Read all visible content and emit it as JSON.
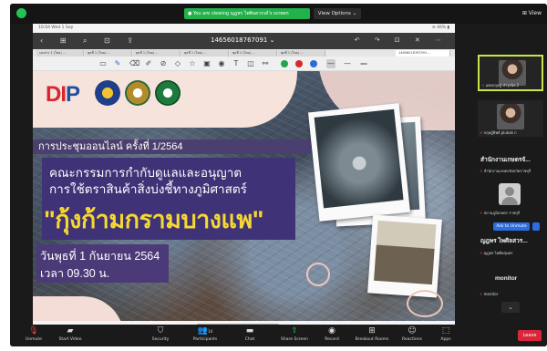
{
  "top": {
    "share_banner": "● You are viewing ญฎพร ไพศิลสวรรค์'s screen",
    "view_options": "View Options ⌄",
    "view_button": "⊞ View"
  },
  "tablet": {
    "status_left": "10:04  Wed 1 Sep",
    "status_right": "⊜ 46% ▮",
    "doc_title": "14656018767091 ⌄",
    "tabs": [
      "เอกสาร 1 (ไทย) ...",
      "พุธที่ 1 (ไทย) ...",
      "พุธที่ 1 (ไทย) ...",
      "พุธที่ 1 (ไทย) ...",
      "พุธที่ 1 (ไทย) ...",
      "พุธที่ 1 (ไทย) ...",
      "14656018767091 ..."
    ],
    "tool_colors": {
      "green": "#1fa64a",
      "red": "#d62a2a",
      "blue": "#2c6bd8"
    }
  },
  "slide": {
    "logo_text_red": "DI",
    "logo_text_blue": "P",
    "meeting": "การประชุมออนไลน์ ครั้งที่ 1/2564",
    "title_line1": "คณะกรรมการกำกับดูแลและอนุญาต",
    "title_line2": "การใช้ตราสินค้าสิ่งบ่งชี้ทางภูมิศาสตร์",
    "title_product": "\"กุ้งก้ามกรามบางแพ\"",
    "date_line1": "วันพุธที่ 1 กันยายน 2564",
    "date_line2": "เวลา 09.30 น."
  },
  "participants": [
    {
      "name": "แพรกฤษฎ์ บำรุงนิล 2",
      "has_video": true
    },
    {
      "name": "กฤษฎ์ทิพย์ plukak ก",
      "has_video": true
    },
    {
      "name": "สำนักงานเกษตรจั...",
      "big": true
    },
    {
      "name": "สำนักงานเกษตรจังหวัดราชบุรี",
      "has_video": false
    },
    {
      "name": "สถานภูมิเกษตร ราชบุรี",
      "has_video": false
    },
    {
      "name": "ญฎพร ไพศิลสวร...",
      "big": true
    },
    {
      "name": "ญฎพร ไพศิลสุนทร",
      "has_video": false
    },
    {
      "name": "monitor",
      "big": true
    },
    {
      "name": "monitor",
      "has_video": false
    }
  ],
  "ask_to_unmute": "Ask to Unmute",
  "toolbar": {
    "unmute": "Unmute",
    "start_video": "Start Video",
    "security": "Security",
    "participants": "Participants",
    "participants_count": "14",
    "chat": "Chat",
    "share_screen": "Share Screen",
    "record": "Record",
    "breakout": "Breakout Rooms",
    "reactions": "Reactions",
    "apps": "Apps",
    "leave": "Leave"
  }
}
